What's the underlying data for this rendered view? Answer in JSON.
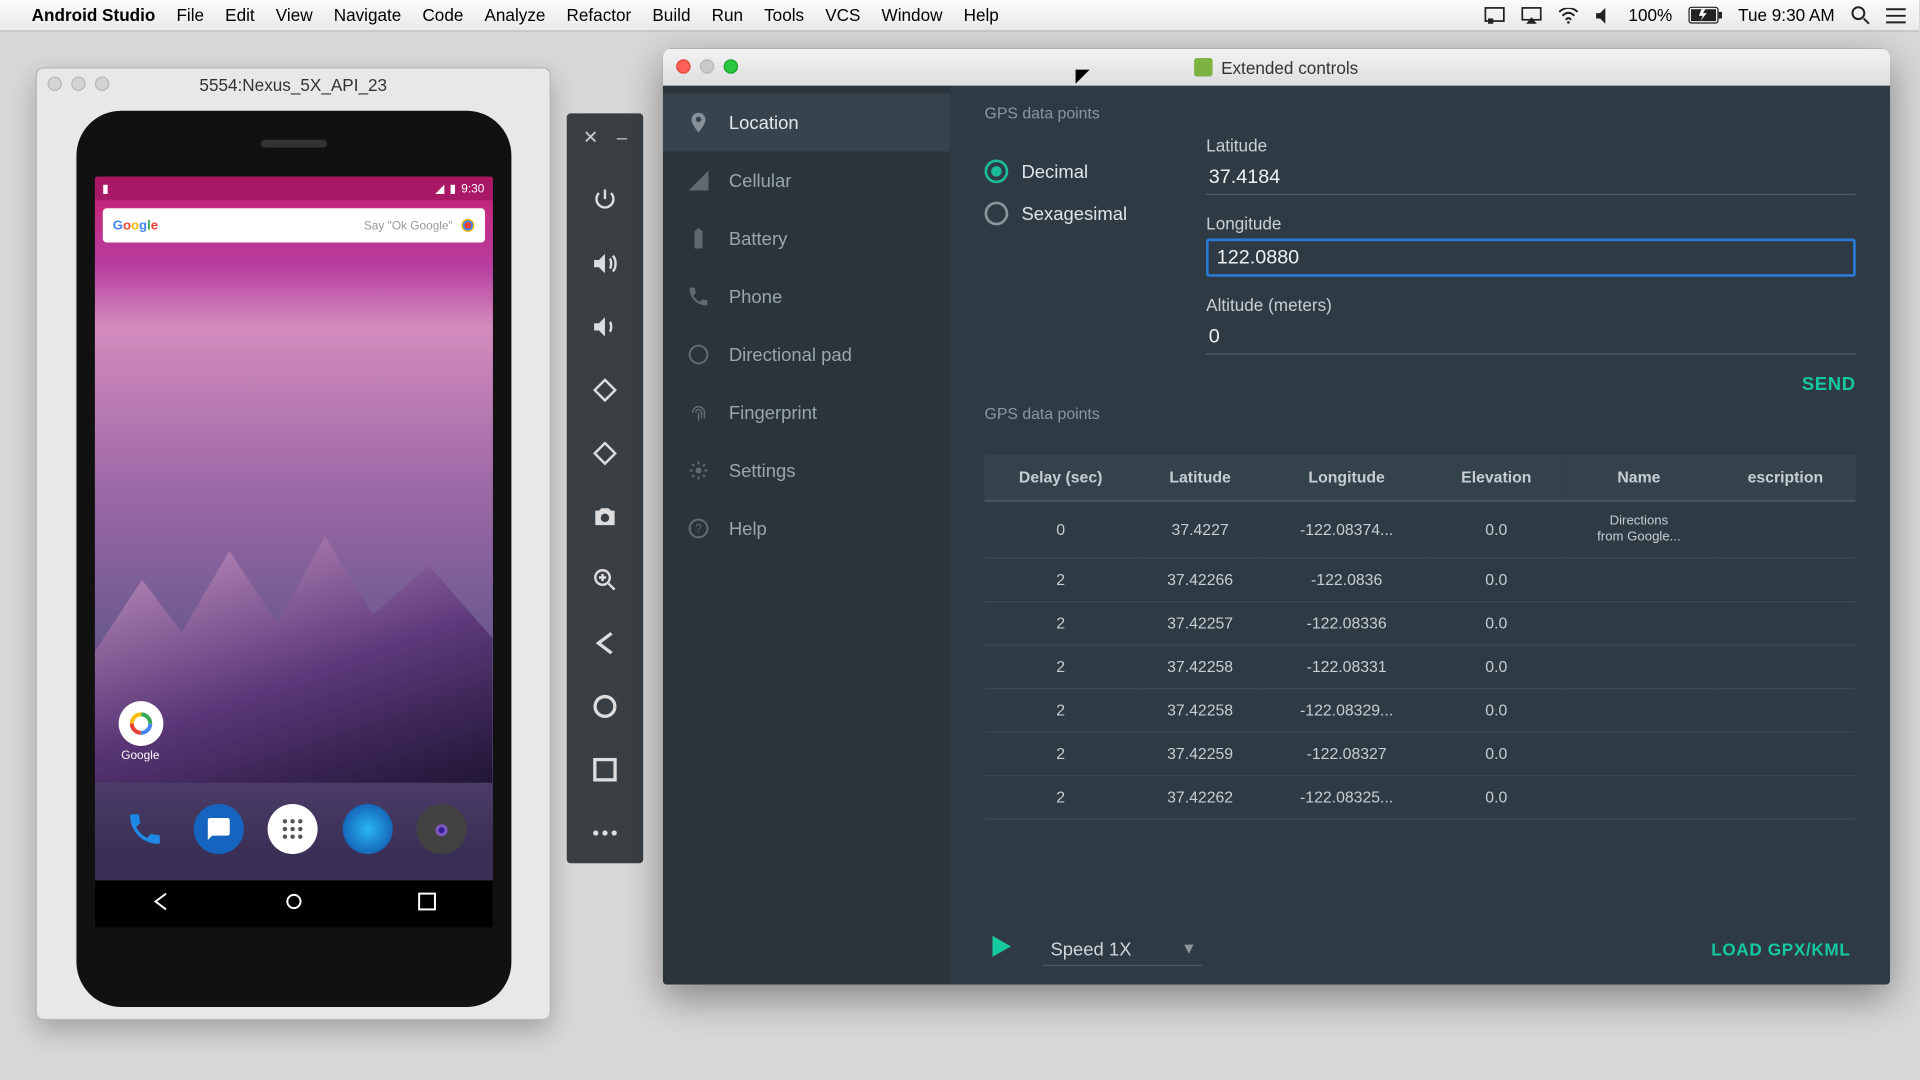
{
  "menubar": {
    "app": "Android Studio",
    "items": [
      "File",
      "Edit",
      "View",
      "Navigate",
      "Code",
      "Analyze",
      "Refactor",
      "Build",
      "Run",
      "Tools",
      "VCS",
      "Window",
      "Help"
    ],
    "battery": "100%",
    "clock": "Tue 9:30 AM"
  },
  "emulator": {
    "title": "5554:Nexus_5X_API_23",
    "status_time": "9:30",
    "search_hint": "Say \"Ok Google\"",
    "google_label": "Google"
  },
  "ext": {
    "title": "Extended controls",
    "sidebar": [
      {
        "label": "Location",
        "active": true
      },
      {
        "label": "Cellular",
        "active": false
      },
      {
        "label": "Battery",
        "active": false
      },
      {
        "label": "Phone",
        "active": false
      },
      {
        "label": "Directional pad",
        "active": false
      },
      {
        "label": "Fingerprint",
        "active": false
      },
      {
        "label": "Settings",
        "active": false
      },
      {
        "label": "Help",
        "active": false
      }
    ],
    "section1": "GPS data points",
    "coord_mode": {
      "decimal": "Decimal",
      "sexagesimal": "Sexagesimal",
      "selected": "Decimal"
    },
    "fields": {
      "lat_label": "Latitude",
      "lat_value": "37.4184",
      "lon_label": "Longitude",
      "lon_value": "122.0880",
      "alt_label": "Altitude (meters)",
      "alt_value": "0"
    },
    "send": "SEND",
    "section2": "GPS data points",
    "table": {
      "headers": [
        "Delay (sec)",
        "Latitude",
        "Longitude",
        "Elevation",
        "Name",
        "escription"
      ],
      "rows": [
        {
          "delay": "0",
          "lat": "37.4227",
          "lon": "-122.08374...",
          "elev": "0.0",
          "name": "Directions from Google..."
        },
        {
          "delay": "2",
          "lat": "37.42266",
          "lon": "-122.0836",
          "elev": "0.0",
          "name": ""
        },
        {
          "delay": "2",
          "lat": "37.42257",
          "lon": "-122.08336",
          "elev": "0.0",
          "name": ""
        },
        {
          "delay": "2",
          "lat": "37.42258",
          "lon": "-122.08331",
          "elev": "0.0",
          "name": ""
        },
        {
          "delay": "2",
          "lat": "37.42258",
          "lon": "-122.08329...",
          "elev": "0.0",
          "name": ""
        },
        {
          "delay": "2",
          "lat": "37.42259",
          "lon": "-122.08327",
          "elev": "0.0",
          "name": ""
        },
        {
          "delay": "2",
          "lat": "37.42262",
          "lon": "-122.08325...",
          "elev": "0.0",
          "name": ""
        }
      ]
    },
    "speed": "Speed 1X",
    "load": "LOAD GPX/KML"
  }
}
